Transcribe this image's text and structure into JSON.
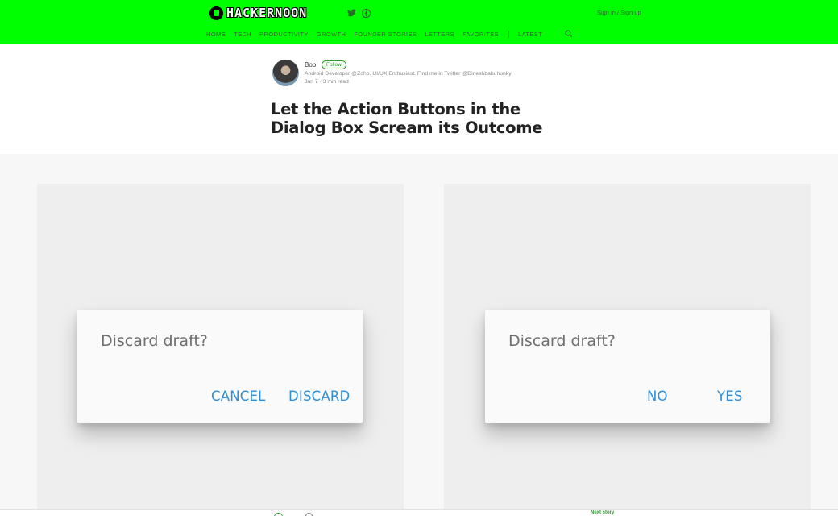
{
  "site": {
    "logo_text": "HACKERNOON",
    "signin": "Sign in / Sign up",
    "icons": [
      "twitter-icon",
      "facebook-icon",
      "search-icon"
    ],
    "brand_color": "#00ff00"
  },
  "nav": {
    "items": [
      "HOME",
      "TECH",
      "PRODUCTIVITY",
      "GROWTH",
      "FOUNDER STORIES",
      "LETTERS",
      "FAVORITES"
    ],
    "latest": "LATEST"
  },
  "author": {
    "name": "Bob",
    "follow_label": "Follow",
    "bio": "Android Developer @Zoho. UI/UX Enthusiast. Find me in Twitter @Dineshbabuhunky",
    "meta": "Jan 7 · 3 min read"
  },
  "article": {
    "title": "Let the Action Buttons in the Dialog Box Scream its Outcome"
  },
  "figures": {
    "left": {
      "dialog_title": "Discard draft?",
      "buttons": [
        "CANCEL",
        "DISCARD"
      ]
    },
    "right": {
      "dialog_title": "Discard draft?",
      "buttons": [
        "NO",
        "YES"
      ]
    },
    "accent_color": "#2f8fd8"
  },
  "bottom_bar": {
    "next_story": "Next story"
  }
}
